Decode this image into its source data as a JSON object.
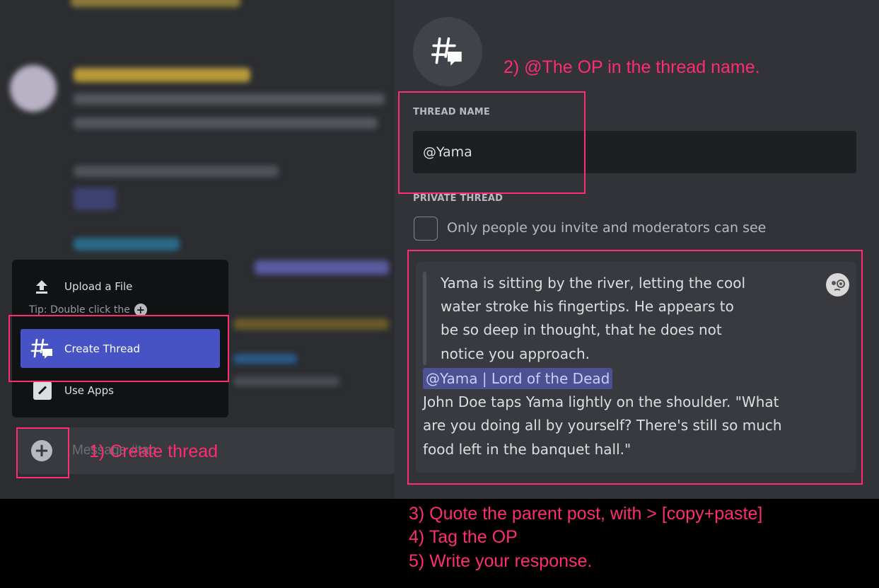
{
  "menu": {
    "upload_label": "Upload a File",
    "tip_text": "Tip: Double click the",
    "create_thread_label": "Create Thread",
    "use_apps_label": "Use Apps"
  },
  "composer": {
    "placeholder_partial": "Message #tab"
  },
  "thread_form": {
    "name_label": "THREAD NAME",
    "name_value": "@Yama",
    "private_label": "PRIVATE THREAD",
    "private_description": "Only people you invite and moderators can see",
    "private_checked": false
  },
  "message": {
    "quote_lines": [
      "Yama is sitting by the river, letting the cool",
      "water stroke his fingertips. He appears to",
      "be so deep in thought, that he does not",
      "notice you approach."
    ],
    "mention": "@Yama | Lord of the Dead",
    "response_lines": [
      "John Doe taps Yama lightly on the shoulder. \"What",
      "are you doing all by yourself? There's still so much",
      "food left in the banquet hall.\""
    ]
  },
  "annotations": {
    "step1": "1) Create thread",
    "step2": "2) @The OP in the thread name.",
    "step3": "3) Quote the parent post, with > [copy+paste]",
    "step4": "4) Tag the OP",
    "step5": "5) Write your response."
  },
  "colors": {
    "annotation_pink": "#ff2d6f",
    "accent_blurple": "#5865f2",
    "panel_bg": "#313338"
  }
}
